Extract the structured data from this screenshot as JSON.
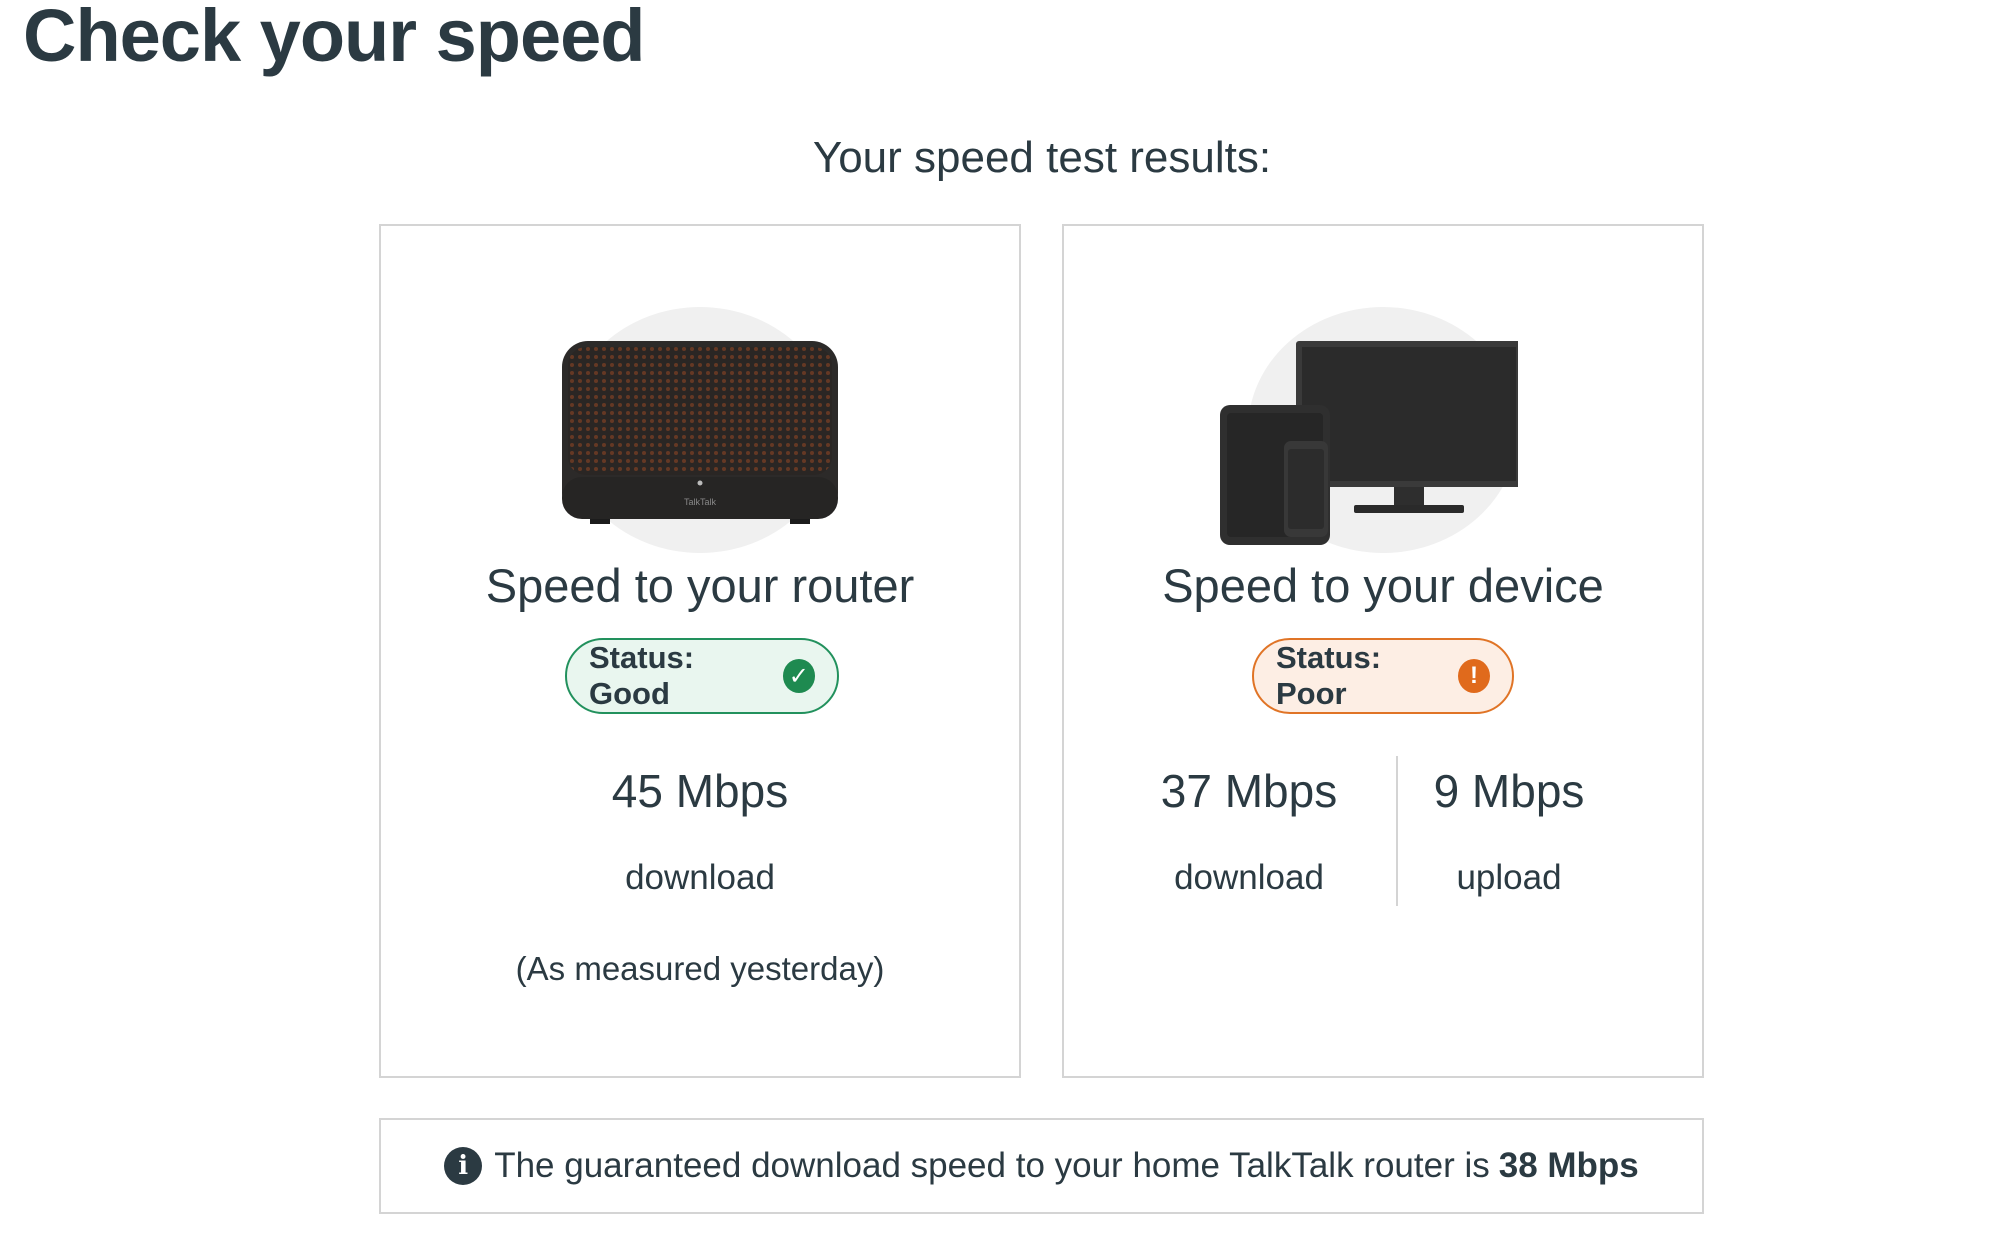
{
  "page": {
    "title": "Check your speed",
    "results_heading": "Your speed test results:"
  },
  "router_card": {
    "title": "Speed to your router",
    "status_label": "Status: Good",
    "status_icon": "check-circle-icon",
    "status_color": "#22915d",
    "download_value": "45 Mbps",
    "download_label": "download",
    "note": "(As measured yesterday)"
  },
  "device_card": {
    "title": "Speed to your device",
    "status_label": "Status: Poor",
    "status_icon": "exclamation-circle-icon",
    "status_color": "#e07426",
    "download_value": "37 Mbps",
    "download_label": "download",
    "upload_value": "9 Mbps",
    "upload_label": "upload"
  },
  "info_bar": {
    "icon": "info-icon",
    "text": "The guaranteed download speed to your home TalkTalk router is",
    "speed": "38 Mbps"
  }
}
